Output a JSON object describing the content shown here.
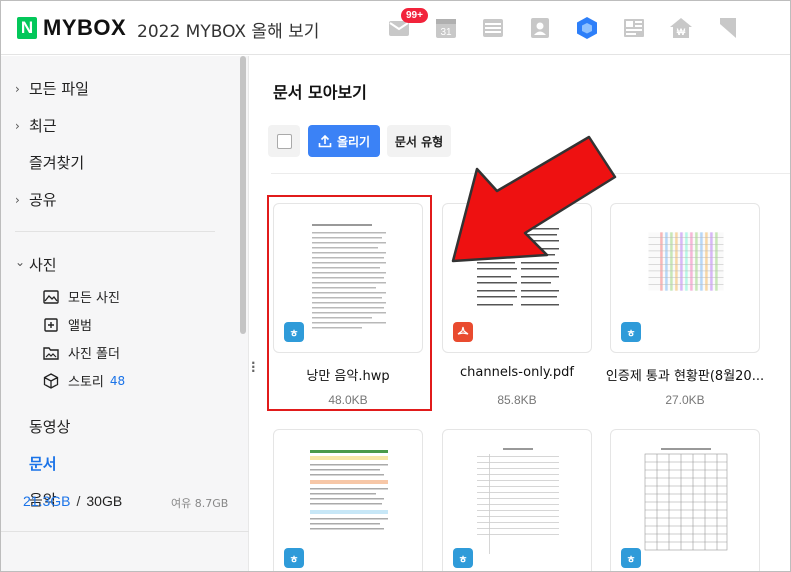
{
  "header": {
    "logo_letter": "N",
    "logo_text": "MYBOX",
    "title": "2022 MYBOX 올해 보기",
    "mail_badge": "99+",
    "calendar_day": "31",
    "icons": [
      "mail-icon",
      "calendar-icon",
      "memo-icon",
      "contacts-icon",
      "mybox-icon",
      "office-icon",
      "home-pay-icon",
      "bookmark-icon"
    ]
  },
  "sidebar": {
    "items": [
      {
        "label": "모든 파일",
        "chevron": "›"
      },
      {
        "label": "최근",
        "chevron": "›"
      },
      {
        "label": "즐겨찾기"
      },
      {
        "label": "공유",
        "chevron": "›"
      }
    ],
    "photo": {
      "label": "사진",
      "chevron": "⌄",
      "sub": [
        {
          "label": "모든 사진",
          "icon": "image-icon"
        },
        {
          "label": "앨범",
          "icon": "album-icon"
        },
        {
          "label": "사진 폴더",
          "icon": "photo-folder-icon"
        },
        {
          "label": "스토리",
          "icon": "cube-icon",
          "count": "48"
        }
      ]
    },
    "media": [
      {
        "label": "동영상"
      },
      {
        "label": "문서",
        "active": true
      },
      {
        "label": "음악"
      }
    ],
    "storage": {
      "used": "21.3GB",
      "total": "30GB",
      "free": "여유 8.7GB"
    }
  },
  "main": {
    "title": "문서 모아보기",
    "upload_label": "올리기",
    "type_label": "문서 유형",
    "files": [
      {
        "name": "낭만 음악.hwp",
        "size": "48.0KB",
        "type": "hwp",
        "type_glyph": "ㅎ"
      },
      {
        "name": "channels-only.pdf",
        "size": "85.8KB",
        "type": "pdf"
      },
      {
        "name": "인증제 통과 현황판(8월20...",
        "size": "27.0KB",
        "type": "hwp",
        "type_glyph": "ㅎ"
      },
      {
        "name": "",
        "size": "",
        "type": "hwp",
        "type_glyph": "ㅎ"
      },
      {
        "name": "",
        "size": "",
        "type": "hwp",
        "type_glyph": "ㅎ"
      },
      {
        "name": "",
        "size": "",
        "type": "hwp",
        "type_glyph": "ㅎ"
      }
    ]
  },
  "colors": {
    "brand_green": "#03c75a",
    "accent_blue": "#3b82f6",
    "highlight_red": "#e11b1b",
    "hwp_blue": "#2f9bd9",
    "pdf_red": "#e94b2f"
  }
}
